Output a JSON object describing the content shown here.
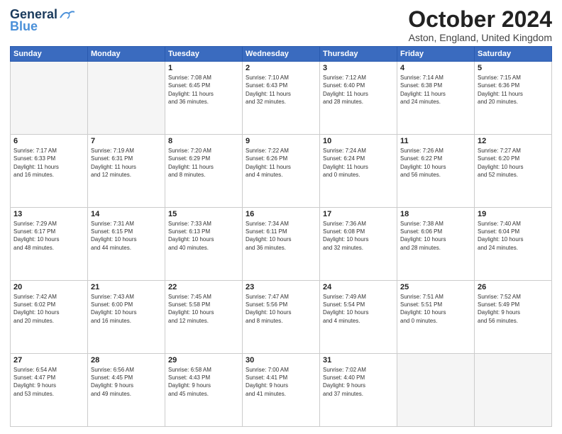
{
  "logo": {
    "line1": "General",
    "line2": "Blue"
  },
  "title": "October 2024",
  "location": "Aston, England, United Kingdom",
  "days_header": [
    "Sunday",
    "Monday",
    "Tuesday",
    "Wednesday",
    "Thursday",
    "Friday",
    "Saturday"
  ],
  "weeks": [
    [
      {
        "day": "",
        "info": ""
      },
      {
        "day": "",
        "info": ""
      },
      {
        "day": "1",
        "info": "Sunrise: 7:08 AM\nSunset: 6:45 PM\nDaylight: 11 hours\nand 36 minutes."
      },
      {
        "day": "2",
        "info": "Sunrise: 7:10 AM\nSunset: 6:43 PM\nDaylight: 11 hours\nand 32 minutes."
      },
      {
        "day": "3",
        "info": "Sunrise: 7:12 AM\nSunset: 6:40 PM\nDaylight: 11 hours\nand 28 minutes."
      },
      {
        "day": "4",
        "info": "Sunrise: 7:14 AM\nSunset: 6:38 PM\nDaylight: 11 hours\nand 24 minutes."
      },
      {
        "day": "5",
        "info": "Sunrise: 7:15 AM\nSunset: 6:36 PM\nDaylight: 11 hours\nand 20 minutes."
      }
    ],
    [
      {
        "day": "6",
        "info": "Sunrise: 7:17 AM\nSunset: 6:33 PM\nDaylight: 11 hours\nand 16 minutes."
      },
      {
        "day": "7",
        "info": "Sunrise: 7:19 AM\nSunset: 6:31 PM\nDaylight: 11 hours\nand 12 minutes."
      },
      {
        "day": "8",
        "info": "Sunrise: 7:20 AM\nSunset: 6:29 PM\nDaylight: 11 hours\nand 8 minutes."
      },
      {
        "day": "9",
        "info": "Sunrise: 7:22 AM\nSunset: 6:26 PM\nDaylight: 11 hours\nand 4 minutes."
      },
      {
        "day": "10",
        "info": "Sunrise: 7:24 AM\nSunset: 6:24 PM\nDaylight: 11 hours\nand 0 minutes."
      },
      {
        "day": "11",
        "info": "Sunrise: 7:26 AM\nSunset: 6:22 PM\nDaylight: 10 hours\nand 56 minutes."
      },
      {
        "day": "12",
        "info": "Sunrise: 7:27 AM\nSunset: 6:20 PM\nDaylight: 10 hours\nand 52 minutes."
      }
    ],
    [
      {
        "day": "13",
        "info": "Sunrise: 7:29 AM\nSunset: 6:17 PM\nDaylight: 10 hours\nand 48 minutes."
      },
      {
        "day": "14",
        "info": "Sunrise: 7:31 AM\nSunset: 6:15 PM\nDaylight: 10 hours\nand 44 minutes."
      },
      {
        "day": "15",
        "info": "Sunrise: 7:33 AM\nSunset: 6:13 PM\nDaylight: 10 hours\nand 40 minutes."
      },
      {
        "day": "16",
        "info": "Sunrise: 7:34 AM\nSunset: 6:11 PM\nDaylight: 10 hours\nand 36 minutes."
      },
      {
        "day": "17",
        "info": "Sunrise: 7:36 AM\nSunset: 6:08 PM\nDaylight: 10 hours\nand 32 minutes."
      },
      {
        "day": "18",
        "info": "Sunrise: 7:38 AM\nSunset: 6:06 PM\nDaylight: 10 hours\nand 28 minutes."
      },
      {
        "day": "19",
        "info": "Sunrise: 7:40 AM\nSunset: 6:04 PM\nDaylight: 10 hours\nand 24 minutes."
      }
    ],
    [
      {
        "day": "20",
        "info": "Sunrise: 7:42 AM\nSunset: 6:02 PM\nDaylight: 10 hours\nand 20 minutes."
      },
      {
        "day": "21",
        "info": "Sunrise: 7:43 AM\nSunset: 6:00 PM\nDaylight: 10 hours\nand 16 minutes."
      },
      {
        "day": "22",
        "info": "Sunrise: 7:45 AM\nSunset: 5:58 PM\nDaylight: 10 hours\nand 12 minutes."
      },
      {
        "day": "23",
        "info": "Sunrise: 7:47 AM\nSunset: 5:56 PM\nDaylight: 10 hours\nand 8 minutes."
      },
      {
        "day": "24",
        "info": "Sunrise: 7:49 AM\nSunset: 5:54 PM\nDaylight: 10 hours\nand 4 minutes."
      },
      {
        "day": "25",
        "info": "Sunrise: 7:51 AM\nSunset: 5:51 PM\nDaylight: 10 hours\nand 0 minutes."
      },
      {
        "day": "26",
        "info": "Sunrise: 7:52 AM\nSunset: 5:49 PM\nDaylight: 9 hours\nand 56 minutes."
      }
    ],
    [
      {
        "day": "27",
        "info": "Sunrise: 6:54 AM\nSunset: 4:47 PM\nDaylight: 9 hours\nand 53 minutes."
      },
      {
        "day": "28",
        "info": "Sunrise: 6:56 AM\nSunset: 4:45 PM\nDaylight: 9 hours\nand 49 minutes."
      },
      {
        "day": "29",
        "info": "Sunrise: 6:58 AM\nSunset: 4:43 PM\nDaylight: 9 hours\nand 45 minutes."
      },
      {
        "day": "30",
        "info": "Sunrise: 7:00 AM\nSunset: 4:41 PM\nDaylight: 9 hours\nand 41 minutes."
      },
      {
        "day": "31",
        "info": "Sunrise: 7:02 AM\nSunset: 4:40 PM\nDaylight: 9 hours\nand 37 minutes."
      },
      {
        "day": "",
        "info": ""
      },
      {
        "day": "",
        "info": ""
      }
    ]
  ]
}
